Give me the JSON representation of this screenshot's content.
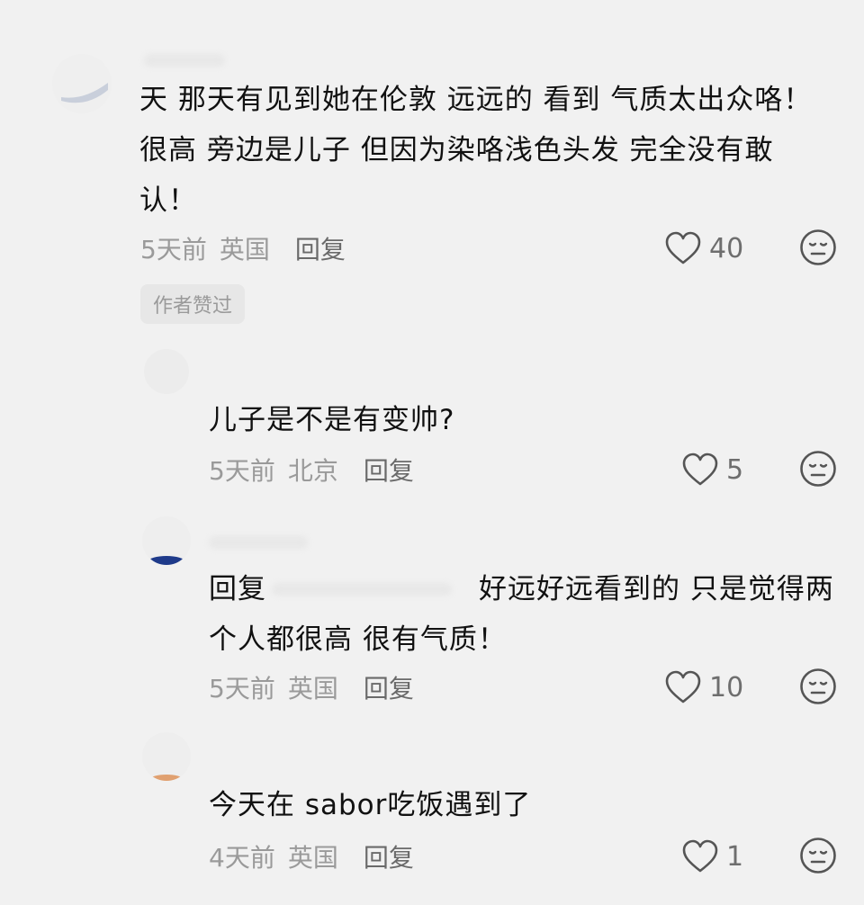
{
  "comments": [
    {
      "text_lines": [
        "天 那天有见到她在伦敦 远远的 看到 气质太出众咯！",
        "很高 旁边是儿子 但因为染咯浅色头发 完全没有敢",
        "认！"
      ],
      "time": "5天前",
      "location": "英国",
      "reply_label": "回复",
      "likes": "40",
      "badge": "作者赞过"
    },
    {
      "text_lines": [
        "儿子是不是有变帅?"
      ],
      "time": "5天前",
      "location": "北京",
      "reply_label": "回复",
      "likes": "5"
    },
    {
      "text_prefix": "回复",
      "text_lines": [
        "好远好远看到的 只是觉得两",
        "个人都很高 很有气质！"
      ],
      "time": "5天前",
      "location": "英国",
      "reply_label": "回复",
      "likes": "10"
    },
    {
      "text_lines": [
        "今天在 sabor吃饭遇到了"
      ],
      "time": "4天前",
      "location": "英国",
      "reply_label": "回复",
      "likes": "1"
    }
  ],
  "icons": {
    "like": "heart-outline-icon",
    "dislike": "neutral-face-icon"
  },
  "colors": {
    "background": "#f1f1f1",
    "text": "#111111",
    "meta": "#9a9a9a"
  }
}
